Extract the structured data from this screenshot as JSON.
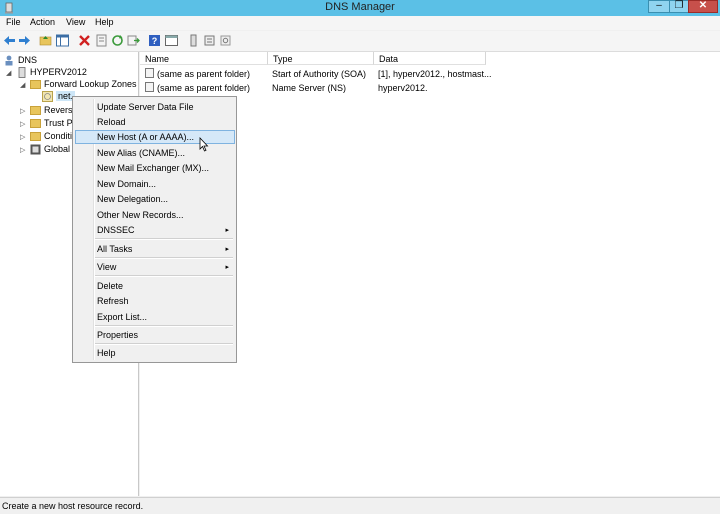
{
  "window": {
    "title": "DNS Manager"
  },
  "window_buttons": {
    "minimize": "–",
    "maximize": "❐",
    "close": "✕"
  },
  "menu": [
    "File",
    "Action",
    "View",
    "Help"
  ],
  "tree": {
    "root": "DNS",
    "server": "HYPERV2012",
    "forward": "Forward Lookup Zones",
    "zone": "net.",
    "reverse": "Reverse",
    "trust": "Trust P",
    "conditional": "Conditi",
    "global": "Global I"
  },
  "columns": {
    "name": "Name",
    "type": "Type",
    "data": "Data"
  },
  "rows": [
    {
      "name": "(same as parent folder)",
      "type": "Start of Authority (SOA)",
      "data": "[1], hyperv2012., hostmast..."
    },
    {
      "name": "(same as parent folder)",
      "type": "Name Server (NS)",
      "data": "hyperv2012."
    }
  ],
  "context_menu": {
    "update": "Update Server Data File",
    "reload": "Reload",
    "new_host": "New Host (A or AAAA)...",
    "new_alias": "New Alias (CNAME)...",
    "new_mx": "New Mail Exchanger (MX)...",
    "new_domain": "New Domain...",
    "new_delegation": "New Delegation...",
    "other_records": "Other New Records...",
    "dnssec": "DNSSEC",
    "all_tasks": "All Tasks",
    "view": "View",
    "delete": "Delete",
    "refresh": "Refresh",
    "export": "Export List...",
    "properties": "Properties",
    "help": "Help",
    "submenu_arrow": "▸"
  },
  "status": {
    "text": "Create a new host resource record."
  },
  "colors": {
    "titlebar": "#5bc0e6",
    "highlight": "#d5e8f8"
  }
}
